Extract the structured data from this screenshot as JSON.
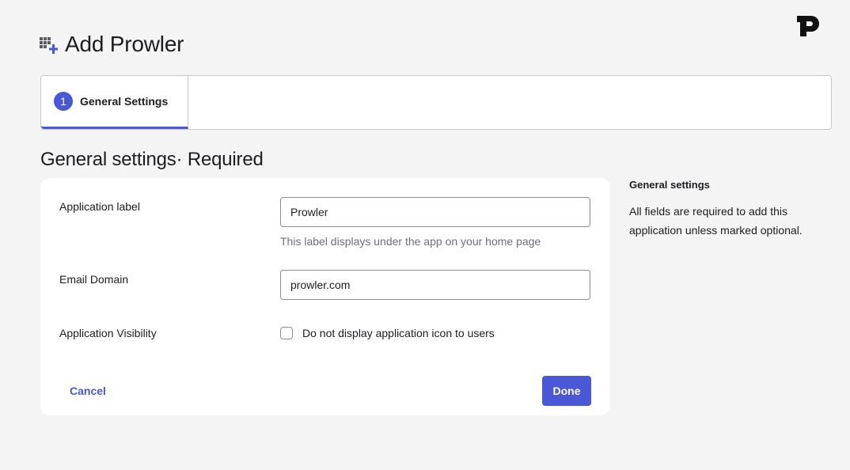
{
  "header": {
    "title": "Add Prowler",
    "title_icon": "app-grid-add-icon",
    "logo_icon": "prowler-p-logo",
    "accent_color": "#4a57d6"
  },
  "stepper": {
    "steps": [
      {
        "number": "1",
        "label": "General Settings",
        "active": true
      }
    ]
  },
  "section": {
    "heading": "General settings· Required"
  },
  "form": {
    "fields": {
      "app_label": {
        "label": "Application label",
        "value": "Prowler",
        "help": "This label displays under the app on your home page"
      },
      "email_domain": {
        "label": "Email Domain",
        "value": "prowler.com"
      },
      "visibility": {
        "label": "Application Visibility",
        "checkbox_label": "Do not display application icon to users",
        "checked": false
      }
    },
    "cancel_label": "Cancel",
    "done_label": "Done"
  },
  "sidebar": {
    "title": "General settings",
    "text": "All fields are required to add this application unless marked optional."
  }
}
